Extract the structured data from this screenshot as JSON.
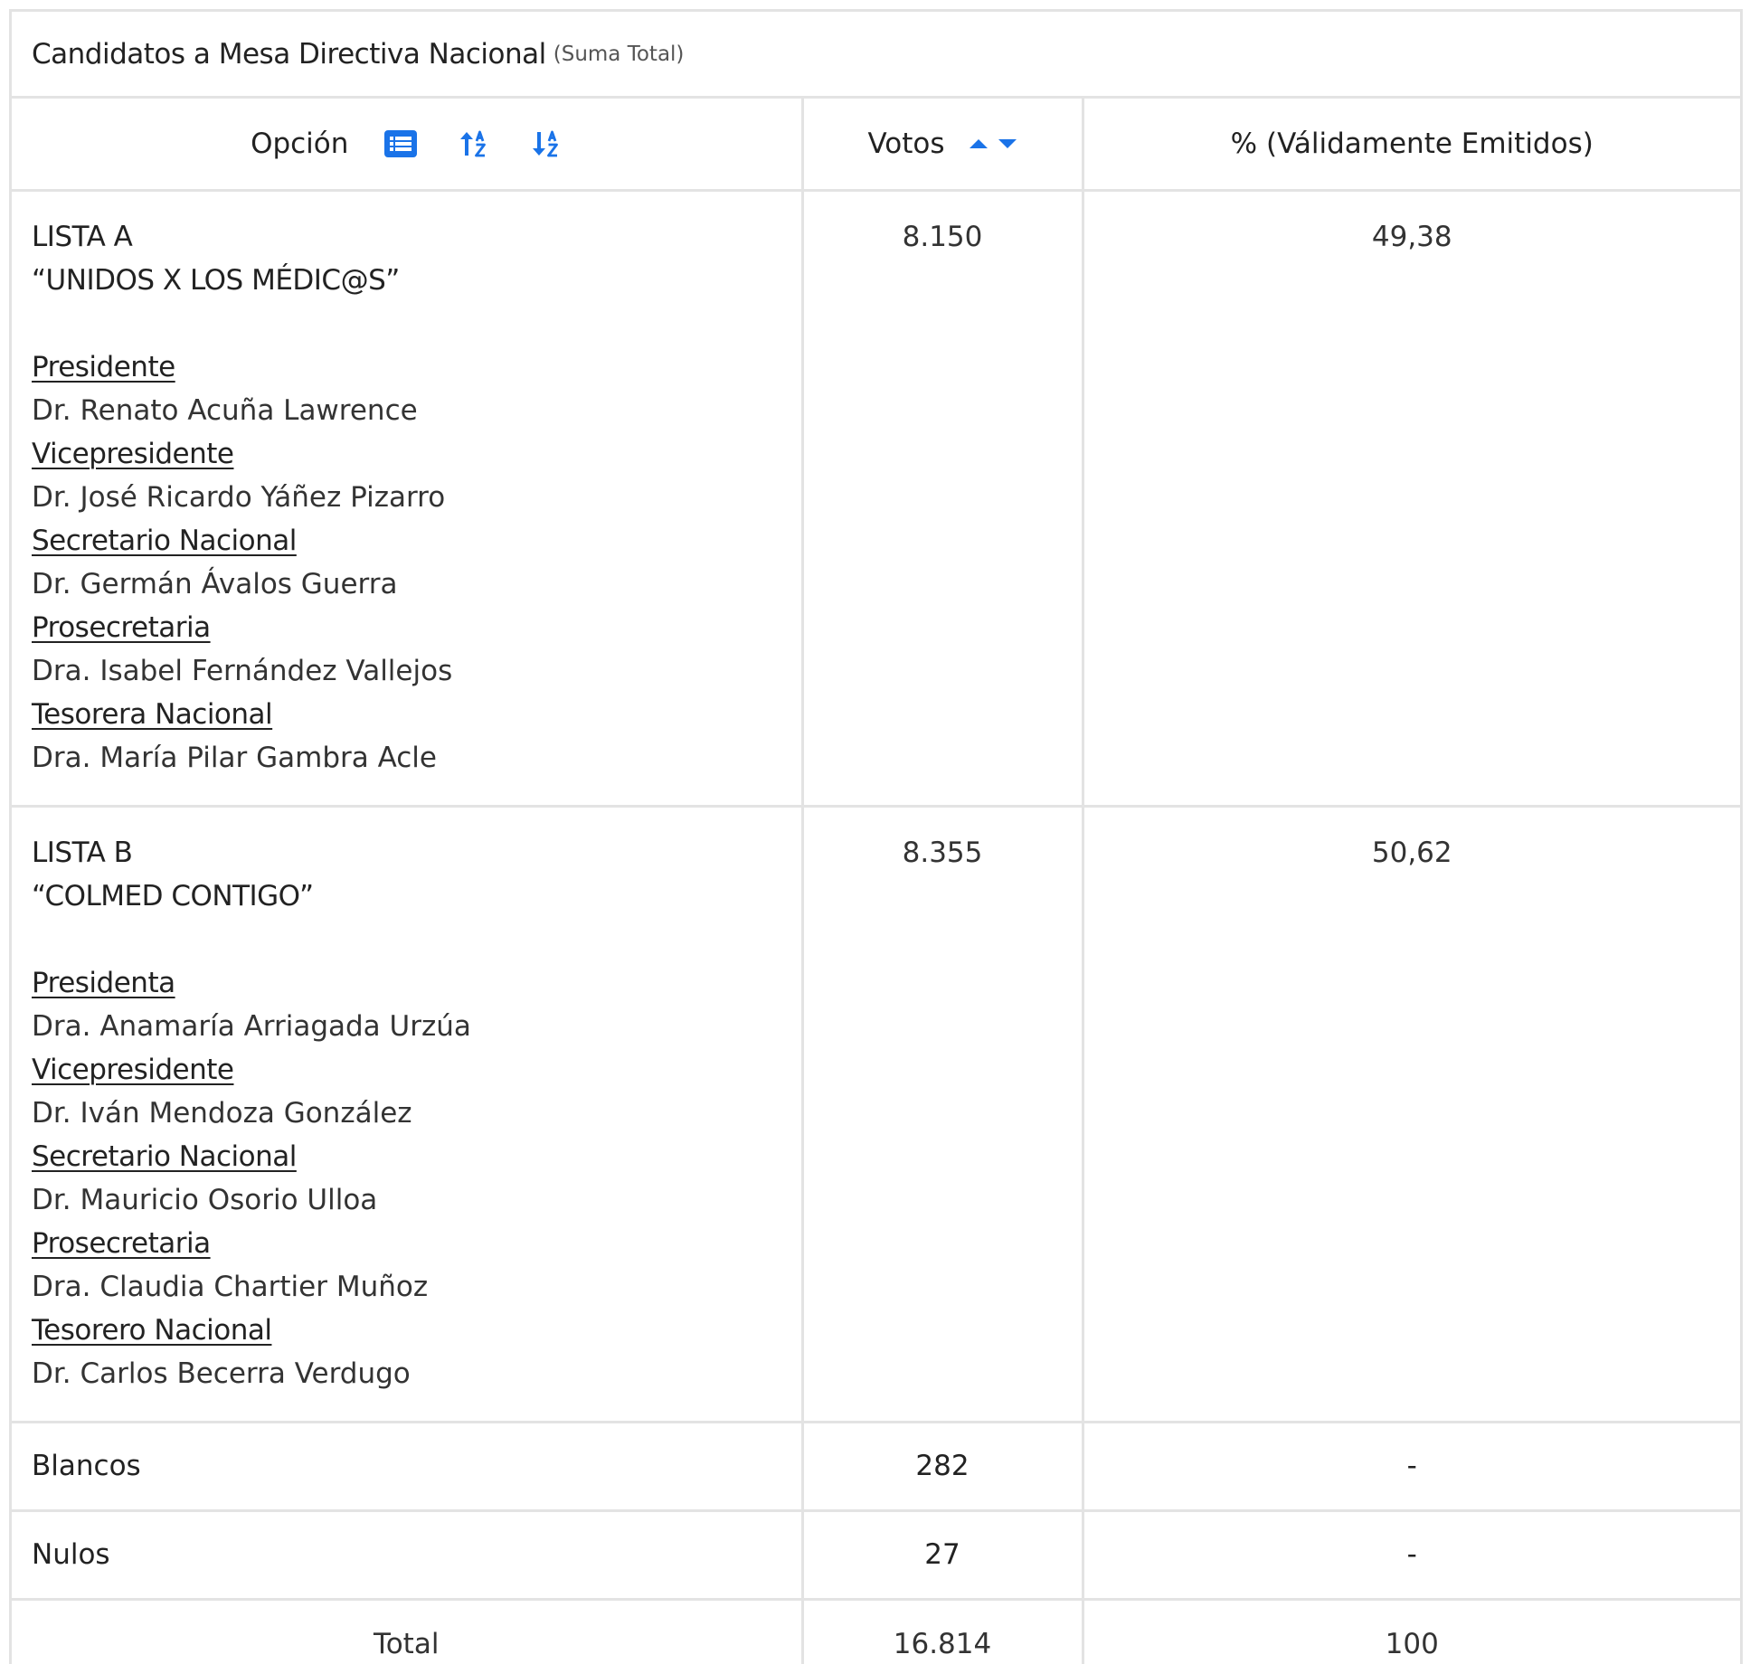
{
  "panel": {
    "title": "Candidatos a Mesa Directiva Nacional",
    "subtitle": "(Suma Total)"
  },
  "table": {
    "headers": {
      "option": "Opción",
      "votes": "Votos",
      "percent": "% (Válidamente Emitidos)"
    },
    "icons": {
      "list": "list-icon",
      "sort_asc": "sort-alpha-up-icon",
      "sort_desc": "sort-alpha-down-icon",
      "caret_up": "caret-up-icon",
      "caret_down": "caret-down-icon"
    },
    "lists": [
      {
        "line1": "LISTA A",
        "line2": "“UNIDOS X LOS MÉDIC@S”",
        "roles": [
          {
            "title": "Presidente",
            "name": "Dr. Renato Acuña Lawrence"
          },
          {
            "title": "Vicepresidente",
            "name": "Dr. José Ricardo Yáñez Pizarro"
          },
          {
            "title": "Secretario Nacional",
            "name": "Dr. Germán Ávalos Guerra"
          },
          {
            "title": "Prosecretaria",
            "name": "Dra. Isabel Fernández Vallejos"
          },
          {
            "title": "Tesorera Nacional",
            "name": "Dra. María Pilar Gambra Acle"
          }
        ],
        "votes": "8.150",
        "percent": "49,38"
      },
      {
        "line1": "LISTA B",
        "line2": "“COLMED CONTIGO”",
        "roles": [
          {
            "title": "Presidenta",
            "name": "Dra. Anamaría Arriagada Urzúa"
          },
          {
            "title": "Vicepresidente",
            "name": "Dr. Iván Mendoza González"
          },
          {
            "title": "Secretario Nacional",
            "name": "Dr. Mauricio Osorio Ulloa"
          },
          {
            "title": "Prosecretaria",
            "name": "Dra. Claudia Chartier Muñoz"
          },
          {
            "title": "Tesorero Nacional",
            "name": "Dr. Carlos Becerra Verdugo"
          }
        ],
        "votes": "8.355",
        "percent": "50,62"
      }
    ],
    "blancos": {
      "label": "Blancos",
      "votes": "282",
      "percent": "-"
    },
    "nulos": {
      "label": "Nulos",
      "votes": "27",
      "percent": "-"
    },
    "total": {
      "label": "Total",
      "votes": "16.814",
      "percent": "100"
    }
  },
  "colors": {
    "accent": "#1a73e8",
    "border": "#e3e3e3",
    "text": "#222222"
  }
}
